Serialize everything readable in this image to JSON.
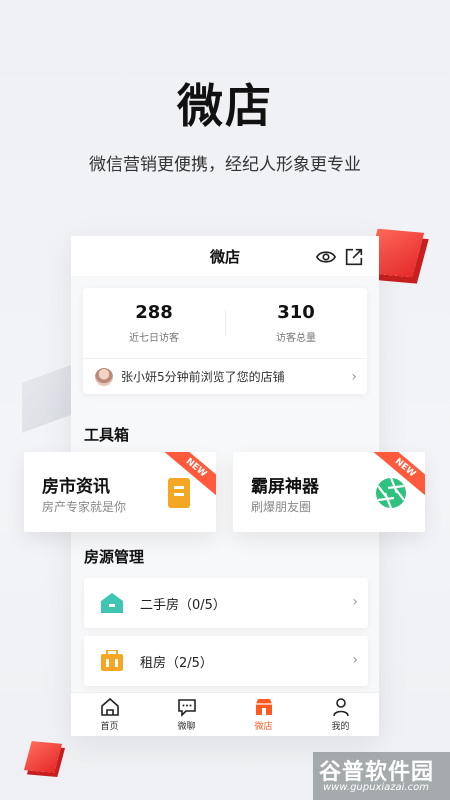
{
  "hero": {
    "title": "微店",
    "subtitle": "微信营销更便携，经纪人形象更专业"
  },
  "phone": {
    "header_title": "微店",
    "stats": [
      {
        "value": "288",
        "label": "近七日访客"
      },
      {
        "value": "310",
        "label": "访客总量"
      }
    ],
    "recent_visitor": "张小妍5分钟前浏览了您的店铺",
    "toolbox_title": "工具箱",
    "tools": [
      {
        "name": "房市资讯",
        "desc": "房产专家就是你",
        "badge": "NEW",
        "icon": "document-icon",
        "color": "#f5a623"
      },
      {
        "name": "霸屏神器",
        "desc": "刷爆朋友圈",
        "badge": "NEW",
        "icon": "camera-aperture-icon",
        "color": "#2ec27e"
      }
    ],
    "listings_title": "房源管理",
    "listings": [
      {
        "label": "二手房（0/5）",
        "icon": "house-icon",
        "color": "#3ec6b2"
      },
      {
        "label": "租房（2/5）",
        "icon": "briefcase-icon",
        "color": "#f5a623"
      }
    ],
    "tabs": [
      {
        "label": "首页",
        "icon": "home-icon"
      },
      {
        "label": "微聊",
        "icon": "chat-icon"
      },
      {
        "label": "微店",
        "icon": "shop-icon",
        "active": true
      },
      {
        "label": "我的",
        "icon": "user-icon"
      }
    ],
    "accent": "#ff5a1f"
  },
  "watermark": {
    "cn": "谷普软件园",
    "en": "www.gupuxiazai.com"
  }
}
